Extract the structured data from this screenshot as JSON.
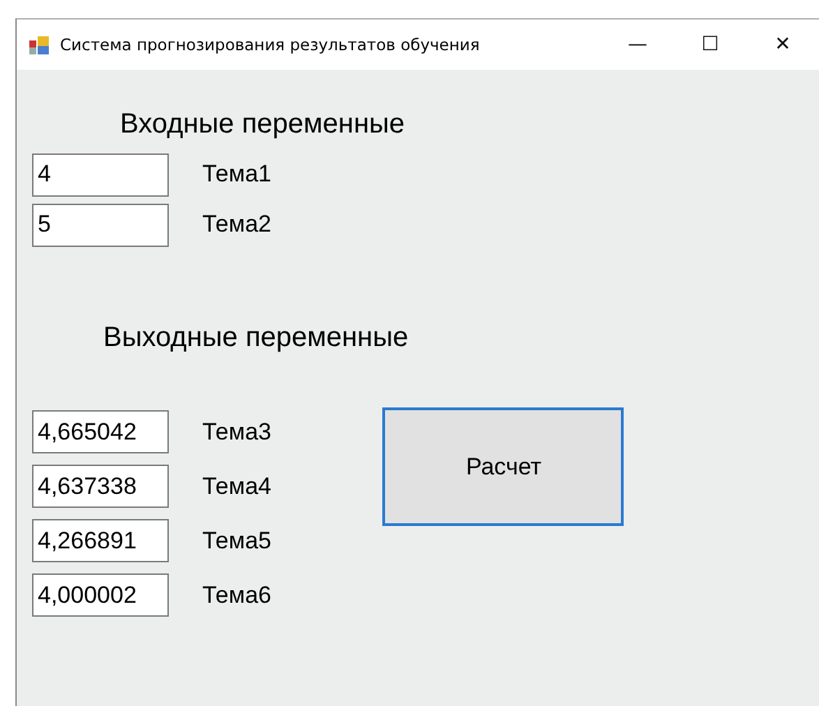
{
  "window": {
    "title": "Система прогнозирования результатов обучения",
    "controls": [
      "—",
      "☐",
      "✕"
    ]
  },
  "inputs": {
    "heading": "Входные переменные",
    "rows": [
      {
        "value": "4",
        "label": "Тема1"
      },
      {
        "value": "5",
        "label": "Тема2"
      }
    ]
  },
  "outputs": {
    "heading": "Выходные переменные",
    "rows": [
      {
        "value": "4,665042",
        "label": "Тема3"
      },
      {
        "value": "4,637338",
        "label": "Тема4"
      },
      {
        "value": "4,266891",
        "label": "Тема5"
      },
      {
        "value": "4,000002",
        "label": "Тема6"
      }
    ]
  },
  "button": {
    "label": "Расчет"
  }
}
